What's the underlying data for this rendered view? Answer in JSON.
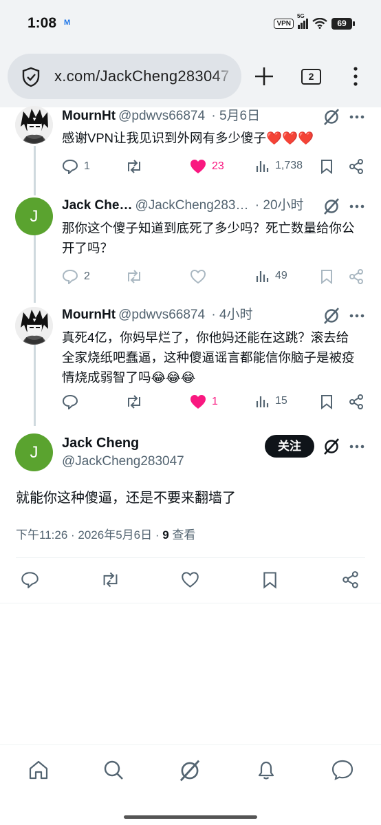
{
  "status_bar": {
    "time": "1:08",
    "mail_icon": "M",
    "vpn": "VPN",
    "network": "5G",
    "battery": "69"
  },
  "browser": {
    "url": "x.com/JackCheng283047",
    "tab_count": "2",
    "icons": [
      "shield-check-icon",
      "plus-icon",
      "tabs-icon",
      "kebab-menu-icon"
    ]
  },
  "thread": [
    {
      "name": "MournHt",
      "handle": "@pdwvs66874",
      "time": "· 5月6日",
      "text": "感谢VPN让我见识到外网有多少傻子❤️❤️❤️",
      "replies": "1",
      "reposts": "",
      "likes": "23",
      "liked": true,
      "views": "1,738",
      "avatar": "anime-avatar"
    },
    {
      "name": "Jack Che…",
      "handle": "@JackCheng283…",
      "time": "· 20小时",
      "text": "那你这个傻子知道到底死了多少吗？死亡数量给你公开了吗？",
      "replies": "2",
      "reposts": "",
      "likes": "",
      "liked": false,
      "views": "49",
      "avatar_letter": "J"
    },
    {
      "name": "MournHt",
      "handle": "@pdwvs66874",
      "time": "· 4小时",
      "text": "真死4亿，你妈早烂了，你他妈还能在这跳？滚去给全家烧纸吧蠢逼，这种傻逼谣言都能信你脑子是被疫情烧成弱智了吗😂😂😂",
      "replies": "",
      "reposts": "",
      "likes": "1",
      "liked": true,
      "views": "15",
      "avatar": "anime-avatar"
    }
  ],
  "main_post": {
    "name": "Jack Cheng",
    "handle": "@JackCheng283047",
    "avatar_letter": "J",
    "follow_label": "关注",
    "text": "就能你这种傻逼，还是不要来翻墙了",
    "timestamp": "下午11:26 · 2026年5月6日 · ",
    "views_count": "9",
    "views_label": " 查看"
  },
  "bottom_nav": [
    "home-icon",
    "search-icon",
    "grok-icon",
    "notifications-bell-icon",
    "messages-icon"
  ],
  "colors": {
    "like_pink": "#f91880",
    "secondary_text": "#536471",
    "avatar_green": "#5aa32f",
    "follow_button": "#0f1419"
  }
}
